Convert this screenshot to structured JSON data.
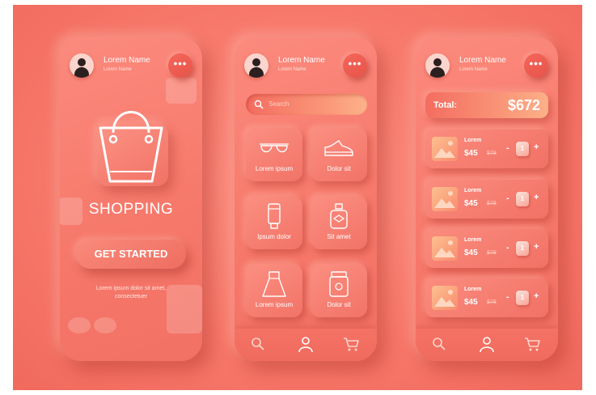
{
  "colors": {
    "accent": "#f7796b",
    "text": "#ffffff",
    "dark_icon": "#2c1f1f"
  },
  "user": {
    "name": "Lorem Name",
    "subtitle": "Lorem Name"
  },
  "more_button": {
    "label": "•••"
  },
  "welcome": {
    "title": "SHOPPING",
    "button": "GET STARTED",
    "blurb": "Lorem ipsum dolor sit amet, consectetuer"
  },
  "catalog": {
    "search_placeholder": "Search",
    "categories": [
      {
        "label": "Lorem ipsum",
        "icon": "sunglasses-icon"
      },
      {
        "label": "Dolor sit",
        "icon": "sneaker-icon"
      },
      {
        "label": "Ipsum dolor",
        "icon": "lotion-tube-icon"
      },
      {
        "label": "Sit amet",
        "icon": "perfume-bottle-icon"
      },
      {
        "label": "Lorem ipsum",
        "icon": "dress-icon"
      },
      {
        "label": "Dolor sit",
        "icon": "jar-icon"
      }
    ]
  },
  "nav": {
    "items": [
      "search-icon",
      "user-icon",
      "cart-icon"
    ]
  },
  "cart": {
    "total_label": "Total:",
    "total_value": "$672",
    "items": [
      {
        "name": "Lorem",
        "price": "$45",
        "old_price": "$79",
        "qty": "1"
      },
      {
        "name": "Lorem",
        "price": "$45",
        "old_price": "$79",
        "qty": "1"
      },
      {
        "name": "Lorem",
        "price": "$45",
        "old_price": "$79",
        "qty": "1"
      },
      {
        "name": "Lorem",
        "price": "$45",
        "old_price": "$79",
        "qty": "1"
      }
    ],
    "minus_label": "-",
    "plus_label": "+"
  }
}
